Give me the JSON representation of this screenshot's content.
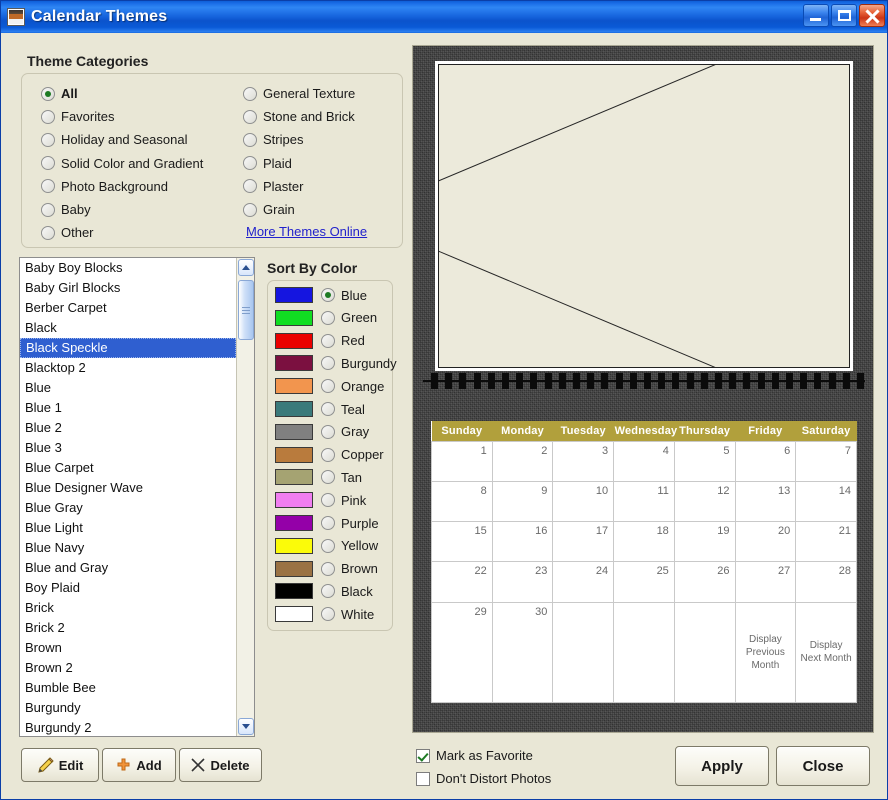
{
  "window": {
    "title": "Calendar Themes",
    "icon": "photo-icon",
    "controls": {
      "minimize": "Minimize",
      "maximize": "Maximize",
      "close": "Close"
    }
  },
  "theme_categories": {
    "title": "Theme Categories",
    "left_column": [
      {
        "label": "All",
        "selected": true
      },
      {
        "label": "Favorites",
        "selected": false
      },
      {
        "label": "Holiday and Seasonal",
        "selected": false
      },
      {
        "label": "Solid Color and Gradient",
        "selected": false
      },
      {
        "label": "Photo Background",
        "selected": false
      },
      {
        "label": "Baby",
        "selected": false
      },
      {
        "label": "Other",
        "selected": false
      }
    ],
    "right_column": [
      {
        "label": "General Texture",
        "selected": false
      },
      {
        "label": "Stone and Brick",
        "selected": false
      },
      {
        "label": "Stripes",
        "selected": false
      },
      {
        "label": "Plaid",
        "selected": false
      },
      {
        "label": "Plaster",
        "selected": false
      },
      {
        "label": "Grain",
        "selected": false
      }
    ],
    "link": "More Themes Online"
  },
  "theme_list": {
    "selected": "Black Speckle",
    "items": [
      "Baby Boy Blocks",
      "Baby Girl Blocks",
      "Berber Carpet",
      "Black",
      "Black Speckle",
      "Blacktop 2",
      "Blue",
      "Blue 1",
      "Blue 2",
      "Blue 3",
      "Blue Carpet",
      "Blue Designer Wave",
      "Blue Gray",
      "Blue Light",
      "Blue Navy",
      "Blue and Gray",
      "Boy Plaid",
      "Brick",
      "Brick 2",
      "Brown",
      "Brown 2",
      "Bumble Bee",
      "Burgundy",
      "Burgundy 2"
    ]
  },
  "sort_by_color": {
    "title": "Sort By Color",
    "options": [
      {
        "label": "Blue",
        "swatch": "#1515e0",
        "selected": true
      },
      {
        "label": "Green",
        "swatch": "#11dd22",
        "selected": false
      },
      {
        "label": "Red",
        "swatch": "#ea0000",
        "selected": false
      },
      {
        "label": "Burgundy",
        "swatch": "#7b1040",
        "selected": false
      },
      {
        "label": "Orange",
        "swatch": "#f2954e",
        "selected": false
      },
      {
        "label": "Teal",
        "swatch": "#3a7a7b",
        "selected": false
      },
      {
        "label": "Gray",
        "swatch": "#808080",
        "selected": false
      },
      {
        "label": "Copper",
        "swatch": "#b97b3d",
        "selected": false
      },
      {
        "label": "Tan",
        "swatch": "#a5a372",
        "selected": false
      },
      {
        "label": "Pink",
        "swatch": "#f07ef0",
        "selected": false
      },
      {
        "label": "Purple",
        "swatch": "#9400a8",
        "selected": false
      },
      {
        "label": "Yellow",
        "swatch": "#fbfb09",
        "selected": false
      },
      {
        "label": "Brown",
        "swatch": "#9a7244",
        "selected": false
      },
      {
        "label": "Black",
        "swatch": "#000000",
        "selected": false
      },
      {
        "label": "White",
        "swatch": "#ffffff",
        "selected": false
      }
    ]
  },
  "list_actions": [
    {
      "label": "Edit",
      "icon": "pencil-icon"
    },
    {
      "label": "Add",
      "icon": "plus-icon"
    },
    {
      "label": "Delete",
      "icon": "x-icon"
    }
  ],
  "preview": {
    "photo_placeholder": "photo-placeholder-x",
    "binding": "spiral-binding",
    "calendar": {
      "day_headers": [
        "Sunday",
        "Monday",
        "Tuesday",
        "Wednesday",
        "Thursday",
        "Friday",
        "Saturday"
      ],
      "weeks": [
        [
          "1",
          "2",
          "3",
          "4",
          "5",
          "6",
          "7"
        ],
        [
          "8",
          "9",
          "10",
          "11",
          "12",
          "13",
          "14"
        ],
        [
          "15",
          "16",
          "17",
          "18",
          "19",
          "20",
          "21"
        ],
        [
          "22",
          "23",
          "24",
          "25",
          "26",
          "27",
          "28"
        ],
        [
          "29",
          "30",
          "",
          "",
          "",
          "Display Previous Month",
          "Display Next Month"
        ]
      ],
      "header_color": "#b1a03c"
    }
  },
  "options": [
    {
      "label": "Mark as Favorite",
      "checked": true
    },
    {
      "label": "Don't Distort Photos",
      "checked": false
    }
  ],
  "dialog_buttons": [
    {
      "label": "Apply"
    },
    {
      "label": "Close"
    }
  ]
}
